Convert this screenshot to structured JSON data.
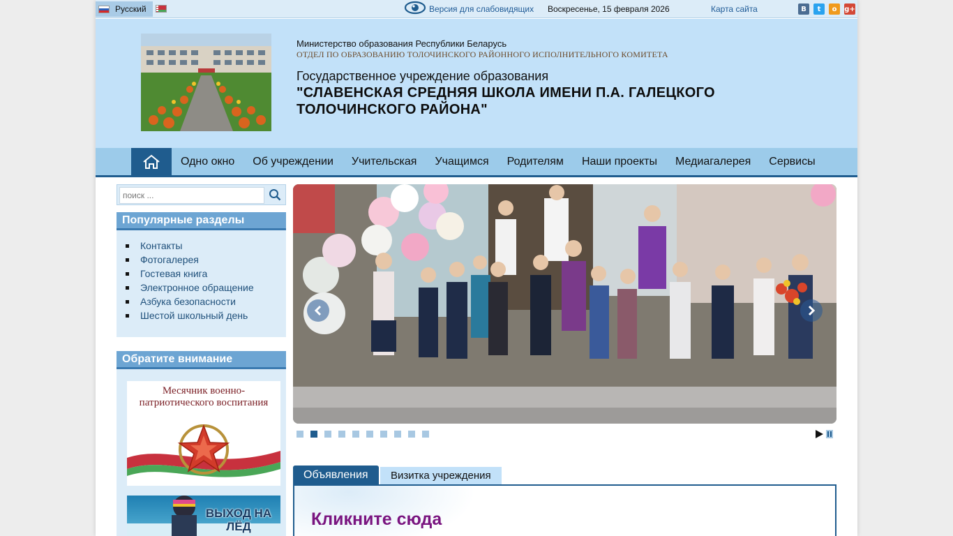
{
  "topbar": {
    "language": "Русский",
    "low_vision": "Версия для слабовидящих",
    "date": "Воскресенье, 15 февраля 2026",
    "sitemap": "Карта сайта",
    "social": {
      "vk": "В",
      "twitter": "t",
      "ok": "о",
      "gplus": "g+"
    }
  },
  "header": {
    "ministry": "Министерство образования Республики Беларусь",
    "department": "ОТДЕЛ ПО ОБРАЗОВАНИЮ  ТОЛОЧИНСКОГО РАЙОННОГО ИСПОЛНИТЕЛЬНОГО КОМИТЕТА",
    "institution": "Государственное учреждение образования",
    "school_name": "\"СЛАВЕНСКАЯ СРЕДНЯЯ ШКОЛА ИМЕНИ П.А. ГАЛЕЦКОГО ТОЛОЧИНСКОГО РАЙОНА\""
  },
  "nav": {
    "items": [
      {
        "label": "Одно окно"
      },
      {
        "label": "Об учреждении"
      },
      {
        "label": "Учительская"
      },
      {
        "label": "Учащимся"
      },
      {
        "label": "Родителям"
      },
      {
        "label": "Наши проекты"
      },
      {
        "label": "Медиагалерея"
      },
      {
        "label": "Сервисы"
      }
    ]
  },
  "search": {
    "placeholder": "поиск ..."
  },
  "popular": {
    "title": "Популярные разделы",
    "items": [
      {
        "label": "Контакты"
      },
      {
        "label": "Фотогалерея"
      },
      {
        "label": "Гостевая книга"
      },
      {
        "label": "Электронное обращение"
      },
      {
        "label": "Азбука безопасности"
      },
      {
        "label": "Шестой школьный день"
      }
    ]
  },
  "attention": {
    "title": "Обратите внимание",
    "banner1": "Месячник военно-патриотического воспитания",
    "banner2": "ВЫХОД НА ЛЁД"
  },
  "slider": {
    "slide_count": 10,
    "active_index": 1
  },
  "tabs": {
    "announcements": "Объявления",
    "card": "Визитка учреждения",
    "click_here": "Кликните сюда"
  }
}
